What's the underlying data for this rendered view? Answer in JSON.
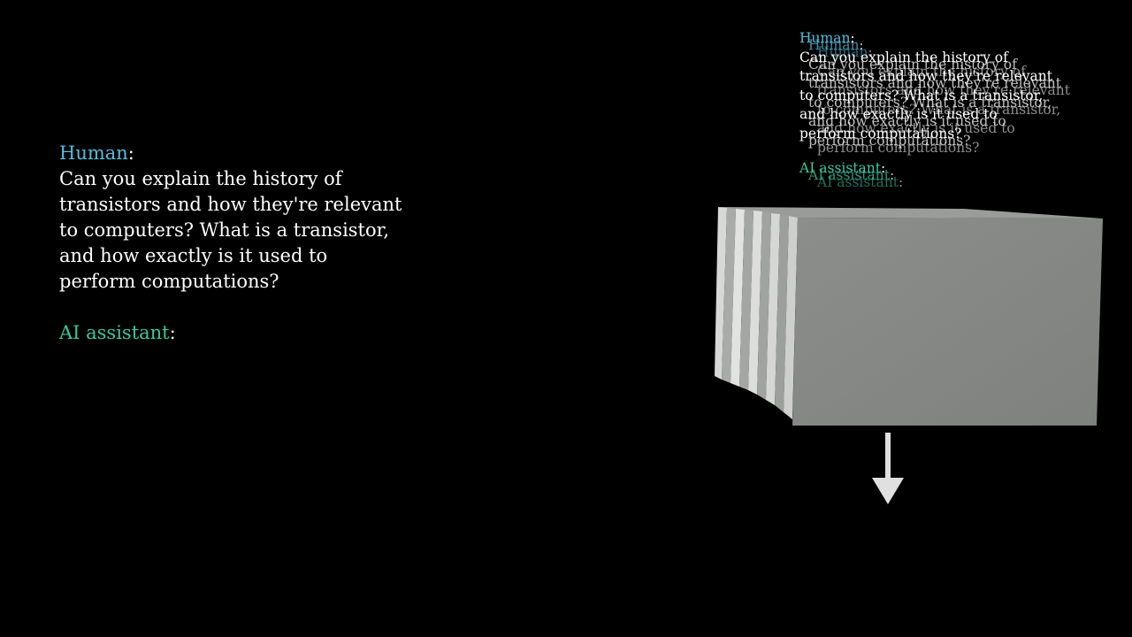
{
  "transcript": {
    "human_label": "Human",
    "separator": ":",
    "question_lines": [
      "Can you explain the history of",
      "transistors and how they're relevant",
      "to computers? What is a transistor,",
      "and how exactly is it used to",
      "perform computations?"
    ],
    "ai_label": "AI assistant"
  },
  "colors": {
    "background": "#000000",
    "human_label": "#55bde0",
    "ai_label": "#38c9a0",
    "text": "#ffffff",
    "block_face": "#888a87",
    "arrow": "#e0e0e0"
  },
  "machine": {
    "shape": "stack-of-layers",
    "arrow_direction": "down"
  }
}
